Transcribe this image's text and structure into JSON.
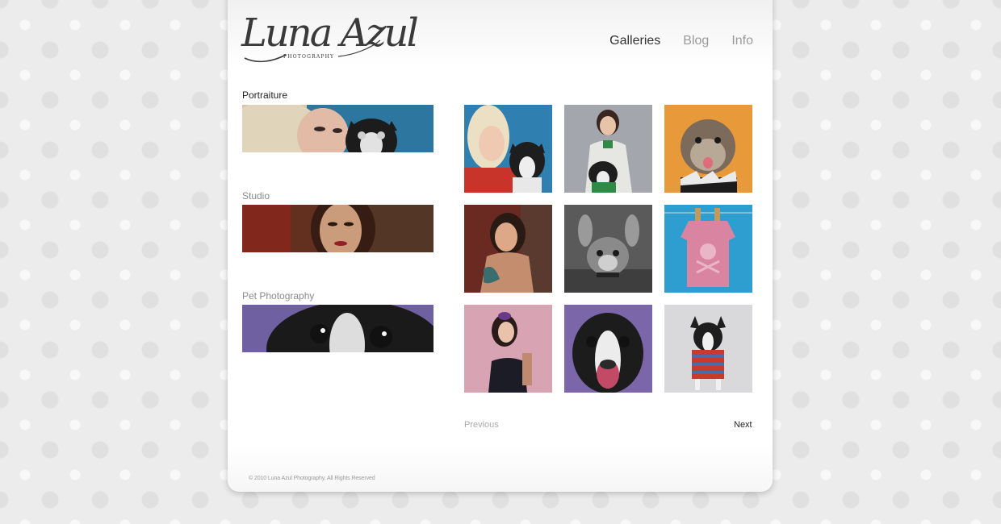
{
  "brand": {
    "logo_text": "Luna Azul",
    "logo_tagline": "PHOTOGRAPHY"
  },
  "nav": {
    "items": [
      {
        "label": "Galleries",
        "active": true
      },
      {
        "label": "Blog",
        "active": false
      },
      {
        "label": "Info",
        "active": false
      }
    ]
  },
  "categories": [
    {
      "label": "Portraiture",
      "active": true
    },
    {
      "label": "Studio",
      "active": false
    },
    {
      "label": "Pet Photography",
      "active": false
    }
  ],
  "gallery": {
    "thumbs": [
      {
        "subject": "blonde woman holding boston terrier",
        "bg": "#2f7fb0"
      },
      {
        "subject": "woman with dog in sweater",
        "bg": "#9a9ea6"
      },
      {
        "subject": "schnauzer on orange",
        "bg": "#e89a3a"
      },
      {
        "subject": "tattooed woman on red",
        "bg": "#6a2a22"
      },
      {
        "subject": "chihuahua black and white",
        "bg": "#6a6a6a"
      },
      {
        "subject": "pink dog sweater on clothesline",
        "bg": "#2e9ed0"
      },
      {
        "subject": "woman in sequin dress on pink",
        "bg": "#d8a4b4"
      },
      {
        "subject": "boston terrier on purple",
        "bg": "#7a66a8"
      },
      {
        "subject": "boston terrier in striped sweater",
        "bg": "#d9d9dc"
      }
    ]
  },
  "pager": {
    "previous_label": "Previous",
    "next_label": "Next"
  },
  "footer": {
    "copyright": "© 2010 Luna Azul Photography, All Rights Reserved"
  },
  "colors": {
    "text_active": "#333333",
    "text_muted": "#9a9a9a",
    "background": "#ececec"
  }
}
